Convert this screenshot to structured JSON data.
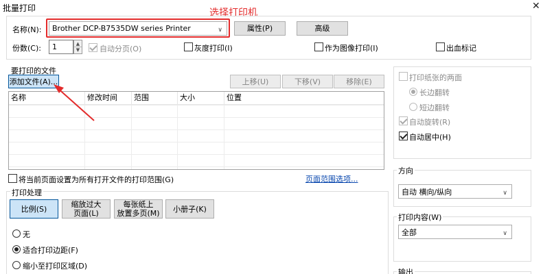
{
  "window": {
    "title": "批量打印",
    "close_glyph": "✕"
  },
  "annotation": {
    "text": "选择打印机",
    "color": "#e32b2b"
  },
  "printer": {
    "name_label": "名称(N):",
    "selected": "Brother DCP-B7535DW series Printer",
    "properties_button": "属性(P)",
    "advanced_button": "高级"
  },
  "copies": {
    "label": "份数(C):",
    "value": "1",
    "collate_label": "自动分页(O)",
    "grayscale_label": "灰度打印(I)",
    "as_image_label": "作为图像打印(I)",
    "bleed_label": "出血标记"
  },
  "files": {
    "section_label": "要打印的文件",
    "add_button": "添加文件(A)...",
    "move_up_button": "上移(U)",
    "move_down_button": "下移(V)",
    "remove_button": "移除(E)",
    "columns": [
      "名称",
      "修改时间",
      "范围",
      "大小",
      "位置"
    ],
    "apply_current_label": "将当前页面设置为所有打开文件的打印范围(G)",
    "range_options_link": "页面范围选项..."
  },
  "handling": {
    "section_label": "打印处理",
    "buttons": [
      "比例(S)",
      "缩放过大\n页面(L)",
      "每张纸上\n放置多页(M)",
      "小册子(K)"
    ],
    "options": [
      "无",
      "适合打印边距(F)",
      "缩小至打印区域(D)"
    ],
    "selected_option": 1
  },
  "duplex": {
    "label": "打印纸张的两面",
    "long_edge": "长边翻转",
    "short_edge": "短边翻转",
    "auto_rotate": "自动旋转(R)",
    "auto_center": "自动居中(H)"
  },
  "orientation": {
    "section_label": "方向",
    "selected": "自动 横向/纵向"
  },
  "content": {
    "section_label": "打印内容(W)",
    "selected": "全部"
  },
  "output": {
    "section_label": "输出"
  }
}
